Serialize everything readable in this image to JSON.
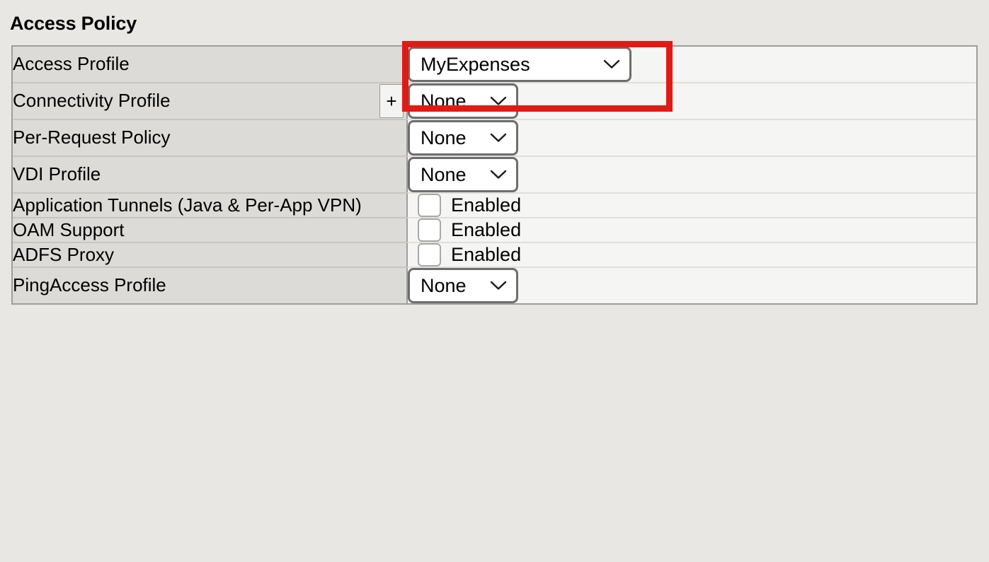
{
  "page": {
    "title": "Access Policy",
    "background_color": "#e8e7e4",
    "highlight_color": "#e01b16"
  },
  "table": {
    "label_column_bg": "#dcdbd7",
    "value_column_bg": "#f5f5f3",
    "border_color": "#9d9d9b",
    "rows": [
      {
        "label": "Access Profile",
        "control": "select",
        "value": "MyExpenses",
        "has_plus": false,
        "highlighted": true
      },
      {
        "label": "Connectivity Profile",
        "control": "select",
        "value": "None",
        "has_plus": true,
        "plus_label": "+",
        "highlighted": false
      },
      {
        "label": "Per-Request Policy",
        "control": "select",
        "value": "None",
        "has_plus": false,
        "highlighted": false
      },
      {
        "label": "VDI Profile",
        "control": "select",
        "value": "None",
        "has_plus": false,
        "highlighted": false
      },
      {
        "label": "Application Tunnels (Java & Per-App VPN)",
        "control": "checkbox",
        "value": "Enabled",
        "checked": false,
        "has_plus": false,
        "highlighted": false
      },
      {
        "label": "OAM Support",
        "control": "checkbox",
        "value": "Enabled",
        "checked": false,
        "has_plus": false,
        "highlighted": false
      },
      {
        "label": "ADFS Proxy",
        "control": "checkbox",
        "value": "Enabled",
        "checked": false,
        "has_plus": false,
        "highlighted": false
      },
      {
        "label": "PingAccess Profile",
        "control": "select",
        "value": "None",
        "has_plus": false,
        "highlighted": false
      }
    ]
  },
  "icons": {
    "chevron": "chevron-down-icon",
    "plus": "plus-icon",
    "checkbox": "checkbox-unchecked-icon"
  }
}
